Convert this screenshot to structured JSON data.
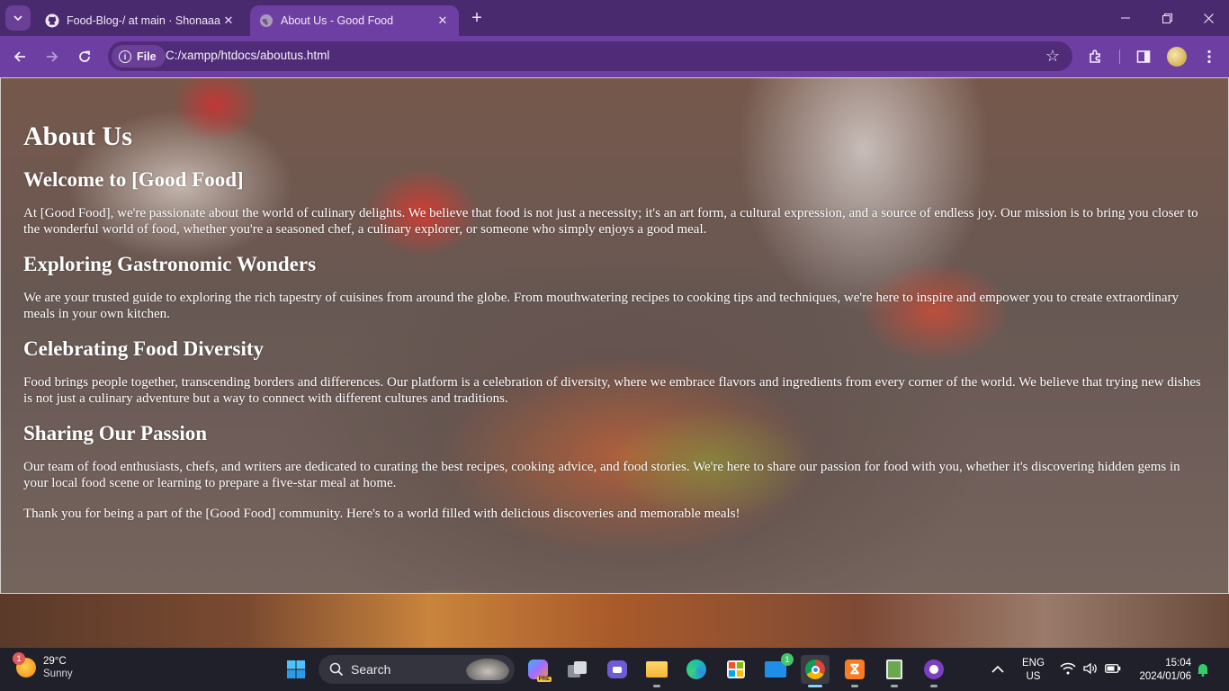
{
  "browser": {
    "tabs": [
      {
        "title": "Food-Blog-/ at main · Shonaaa",
        "favicon": "github-icon",
        "active": false
      },
      {
        "title": "About Us - Good Food",
        "favicon": "globe-icon",
        "active": true
      }
    ],
    "address_chip": "File",
    "url": "C:/xampp/htdocs/aboutus.html"
  },
  "page": {
    "heading": "About Us",
    "sections": [
      {
        "title": "Welcome to [Good Food]",
        "paragraphs": [
          "At [Good Food], we're passionate about the world of culinary delights. We believe that food is not just a necessity; it's an art form, a cultural expression, and a source of endless joy. Our mission is to bring you closer to the wonderful world of food, whether you're a seasoned chef, a culinary explorer, or someone who simply enjoys a good meal."
        ]
      },
      {
        "title": "Exploring Gastronomic Wonders",
        "paragraphs": [
          "We are your trusted guide to exploring the rich tapestry of cuisines from around the globe. From mouthwatering recipes to cooking tips and techniques, we're here to inspire and empower you to create extraordinary meals in your own kitchen."
        ]
      },
      {
        "title": "Celebrating Food Diversity",
        "paragraphs": [
          "Food brings people together, transcending borders and differences. Our platform is a celebration of diversity, where we embrace flavors and ingredients from every corner of the world. We believe that trying new dishes is not just a culinary adventure but a way to connect with different cultures and traditions."
        ]
      },
      {
        "title": "Sharing Our Passion",
        "paragraphs": [
          "Our team of food enthusiasts, chefs, and writers are dedicated to curating the best recipes, cooking advice, and food stories. We're here to share our passion for food with you, whether it's discovering hidden gems in your local food scene or learning to prepare a five-star meal at home.",
          "Thank you for being a part of the [Good Food] community. Here's to a world filled with delicious discoveries and memorable meals!"
        ]
      }
    ]
  },
  "taskbar": {
    "weather": {
      "temp": "29°C",
      "condition": "Sunny",
      "badge": "1"
    },
    "search_placeholder": "Search",
    "mail_badge": "1",
    "language": "ENG",
    "region": "US",
    "time": "15:04",
    "date": "2024/01/06"
  },
  "colors": {
    "tabstrip": "#4a2a6e",
    "toolbar": "#6e3fa3",
    "taskbar": "#20202a"
  }
}
